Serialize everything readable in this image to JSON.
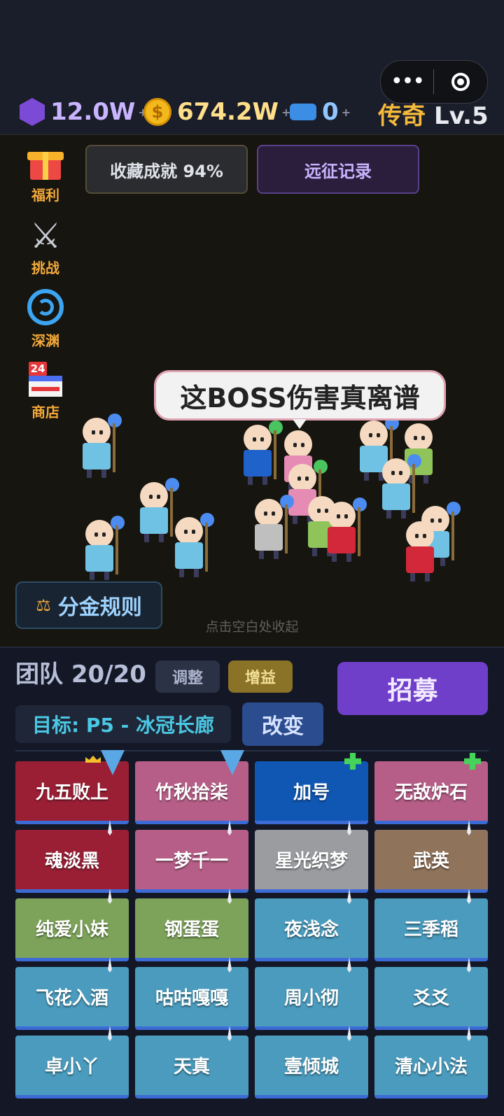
{
  "header": {
    "gems": "12.0W",
    "gold": "674.2W",
    "tickets": "0",
    "plus": "+",
    "rank": "传奇",
    "level": "Lv.5",
    "menu_dots": "•••"
  },
  "sidebar": [
    {
      "label": "福利",
      "icon": "gift-icon"
    },
    {
      "label": "挑战",
      "icon": "crossed-swords-icon"
    },
    {
      "label": "深渊",
      "icon": "vortex-icon"
    },
    {
      "label": "商店",
      "icon": "shop-icon",
      "badge": "24"
    }
  ],
  "battle": {
    "collection_btn": "收藏成就 94%",
    "record_btn": "远征记录",
    "speech": "这BOSS伤害真离谱",
    "rule_btn": "分金规则",
    "hint": "点击空白处收起"
  },
  "team": {
    "title": "团队 20/20",
    "adjust_label": "调整",
    "buff_label": "增益",
    "recruit_label": "招募",
    "target_label": "目标: P5 - 冰冠长廊",
    "change_label": "改变",
    "members": [
      {
        "name": "九五败上",
        "color": "#9a1f35",
        "badge": "shield",
        "crown": true
      },
      {
        "name": "竹秋拾柒",
        "color": "#b65e87",
        "badge": "shield"
      },
      {
        "name": "加号",
        "color": "#0f57b3",
        "badge": "heal"
      },
      {
        "name": "无敌炉石",
        "color": "#b65e87",
        "badge": "heal"
      },
      {
        "name": "魂淡黑",
        "color": "#9a1f35",
        "badge": "knife"
      },
      {
        "name": "一梦千一",
        "color": "#b65e87",
        "badge": "knife"
      },
      {
        "name": "星光织梦",
        "color": "#9a9ca0",
        "badge": "knife"
      },
      {
        "name": "武英",
        "color": "#8f735a",
        "badge": "knife"
      },
      {
        "name": "纯爱小妹",
        "color": "#7da35a",
        "badge": "knife"
      },
      {
        "name": "钢蛋蛋",
        "color": "#7da35a",
        "badge": "knife"
      },
      {
        "name": "夜浅念",
        "color": "#4a9bbd",
        "badge": "knife"
      },
      {
        "name": "三季稻",
        "color": "#4a9bbd",
        "badge": "knife"
      },
      {
        "name": "飞花入酒",
        "color": "#4a9bbd",
        "badge": "knife"
      },
      {
        "name": "咕咕嘎嘎",
        "color": "#4a9bbd",
        "badge": "knife"
      },
      {
        "name": "周小彻",
        "color": "#4a9bbd",
        "badge": "knife"
      },
      {
        "name": "爻爻",
        "color": "#4a9bbd",
        "badge": "knife"
      },
      {
        "name": "卓小丫",
        "color": "#4a9bbd",
        "badge": "knife"
      },
      {
        "name": "天真",
        "color": "#4a9bbd",
        "badge": "knife"
      },
      {
        "name": "壹倾城",
        "color": "#4a9bbd",
        "badge": "knife"
      },
      {
        "name": "清心小法",
        "color": "#4a9bbd",
        "badge": "knife"
      }
    ]
  },
  "colors": {
    "background": "#181b28",
    "accent_purple": "#6f3fc9",
    "gold_text": "#f5b93c",
    "cyan_text": "#4bc7e3"
  }
}
